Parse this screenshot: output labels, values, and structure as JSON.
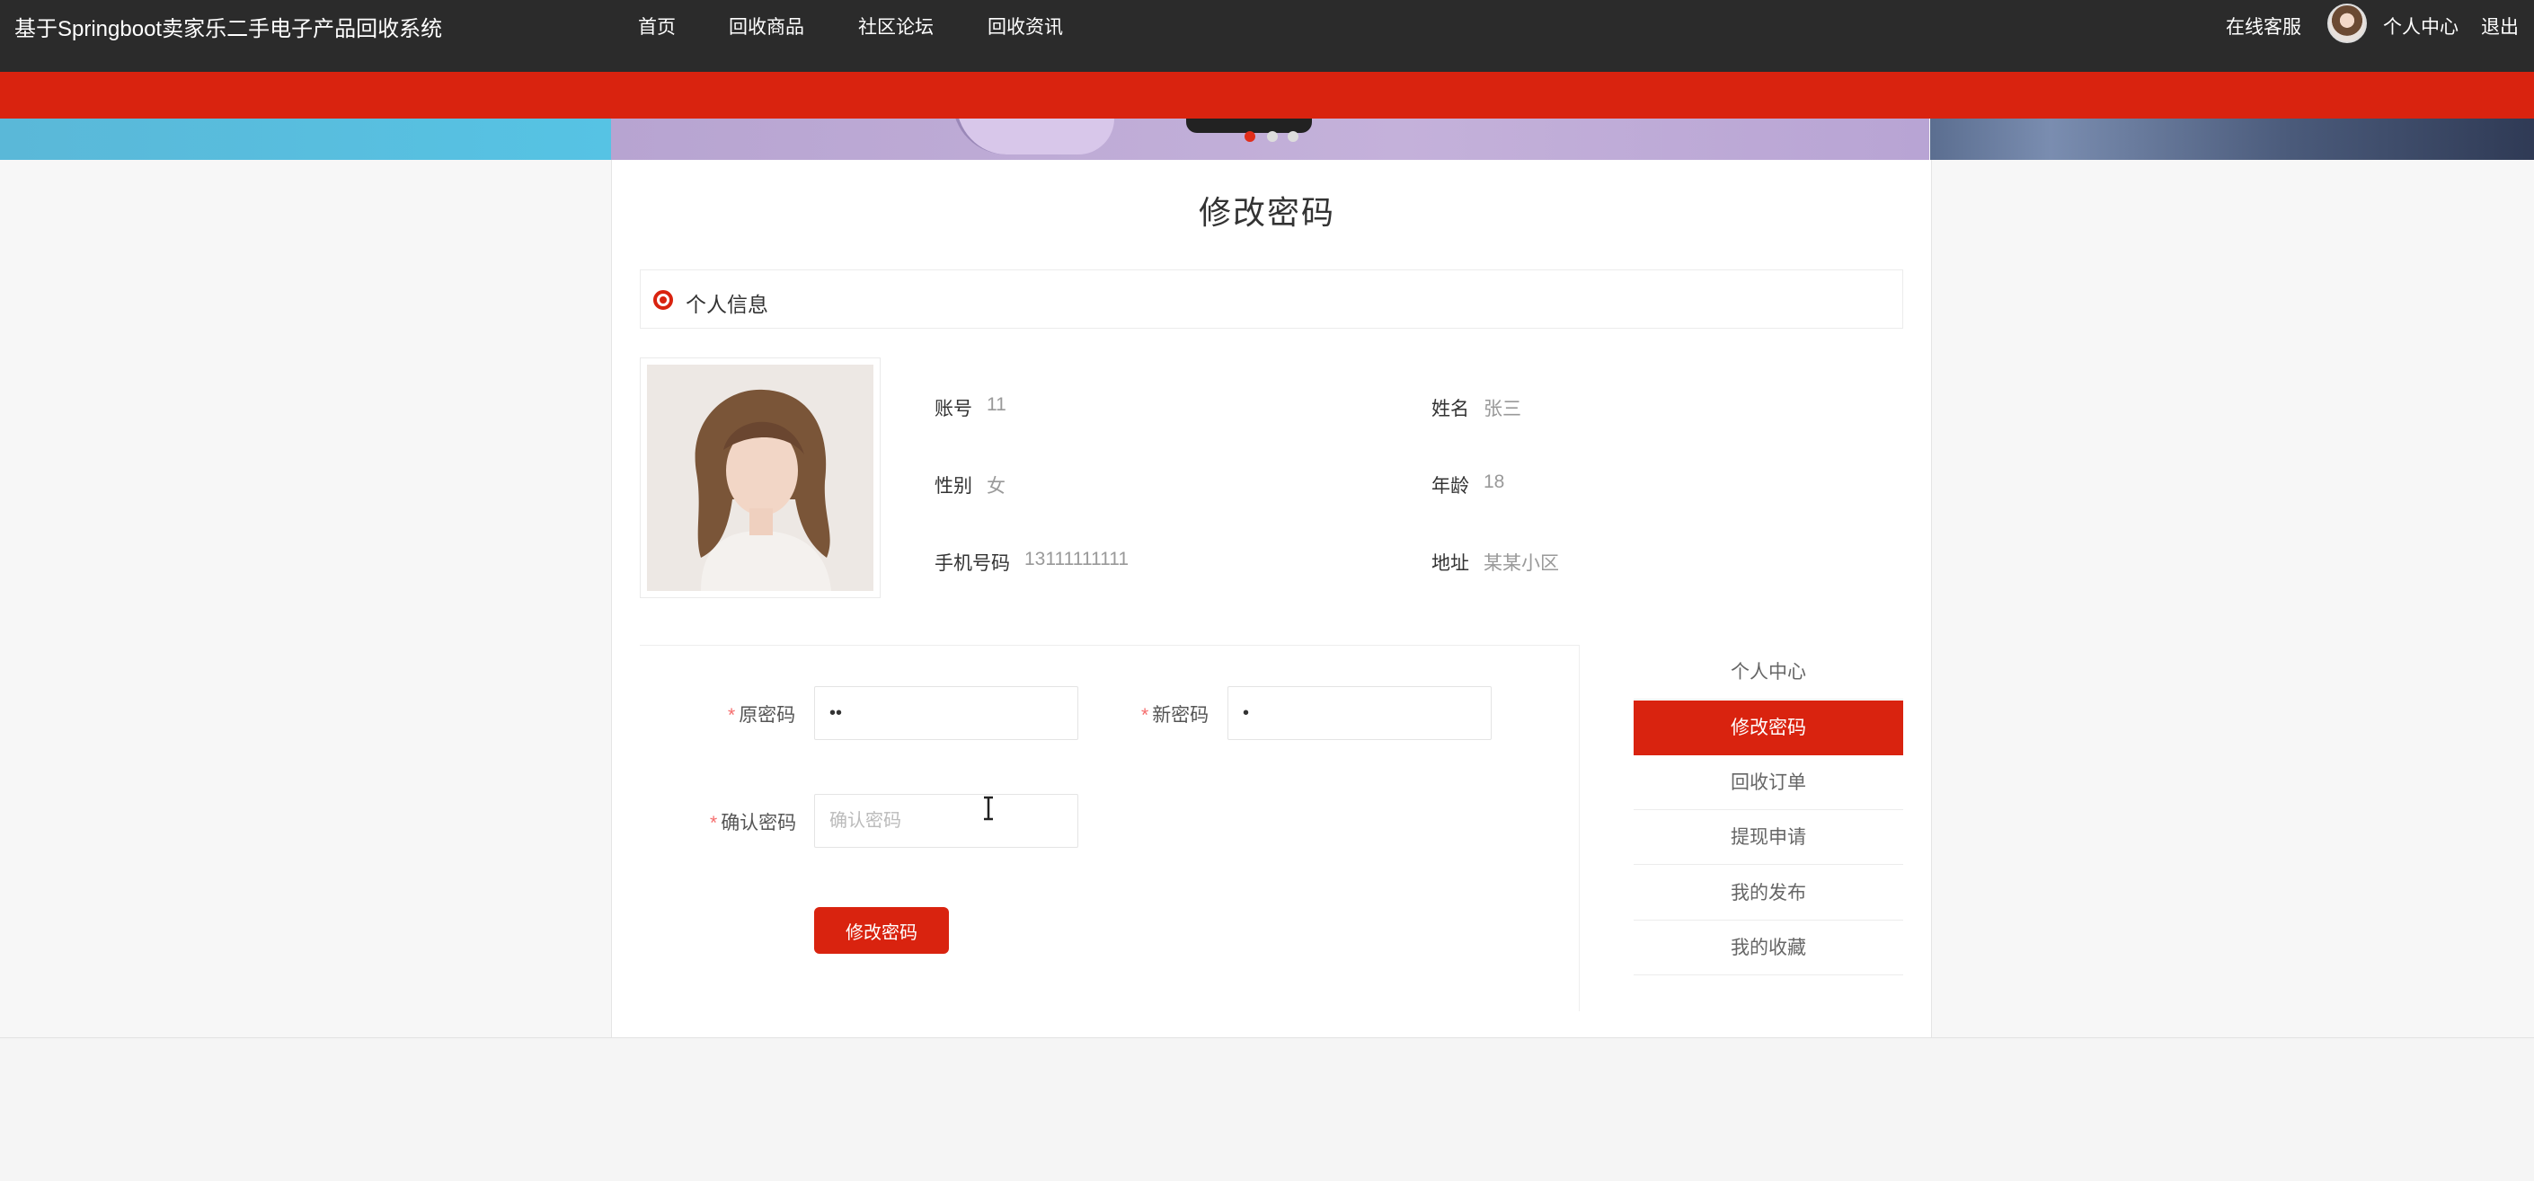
{
  "header": {
    "site_title": "基于Springboot卖家乐二手电子产品回收系统",
    "nav": [
      "首页",
      "回收商品",
      "社区论坛",
      "回收资讯"
    ],
    "right": {
      "service": "在线客服",
      "user_center": "个人中心",
      "logout": "退出"
    }
  },
  "page": {
    "title": "修改密码"
  },
  "profile": {
    "section_label": "个人信息",
    "fields": {
      "account": {
        "label": "账号",
        "value": "11"
      },
      "name": {
        "label": "姓名",
        "value": "张三"
      },
      "gender": {
        "label": "性别",
        "value": "女"
      },
      "age": {
        "label": "年龄",
        "value": "18"
      },
      "phone": {
        "label": "手机号码",
        "value": "13111111111"
      },
      "address": {
        "label": "地址",
        "value": "某某小区"
      }
    }
  },
  "form": {
    "old_password": {
      "required_mark": "*",
      "label": "原密码",
      "value": "••"
    },
    "new_password": {
      "required_mark": "*",
      "label": "新密码",
      "value": "•"
    },
    "confirm_password": {
      "required_mark": "*",
      "label": "确认密码",
      "value": "",
      "placeholder": "确认密码"
    },
    "submit_label": "修改密码"
  },
  "side_menu": [
    {
      "label": "个人中心",
      "active": false
    },
    {
      "label": "修改密码",
      "active": true
    },
    {
      "label": "回收订单",
      "active": false
    },
    {
      "label": "提现申请",
      "active": false
    },
    {
      "label": "我的发布",
      "active": false
    },
    {
      "label": "我的收藏",
      "active": false
    }
  ],
  "carousel": {
    "slide_count": 3,
    "active_index": 0
  },
  "colors": {
    "accent": "#d9230f",
    "nav_bg": "#2b2b2b",
    "required": "#f56c6c"
  }
}
